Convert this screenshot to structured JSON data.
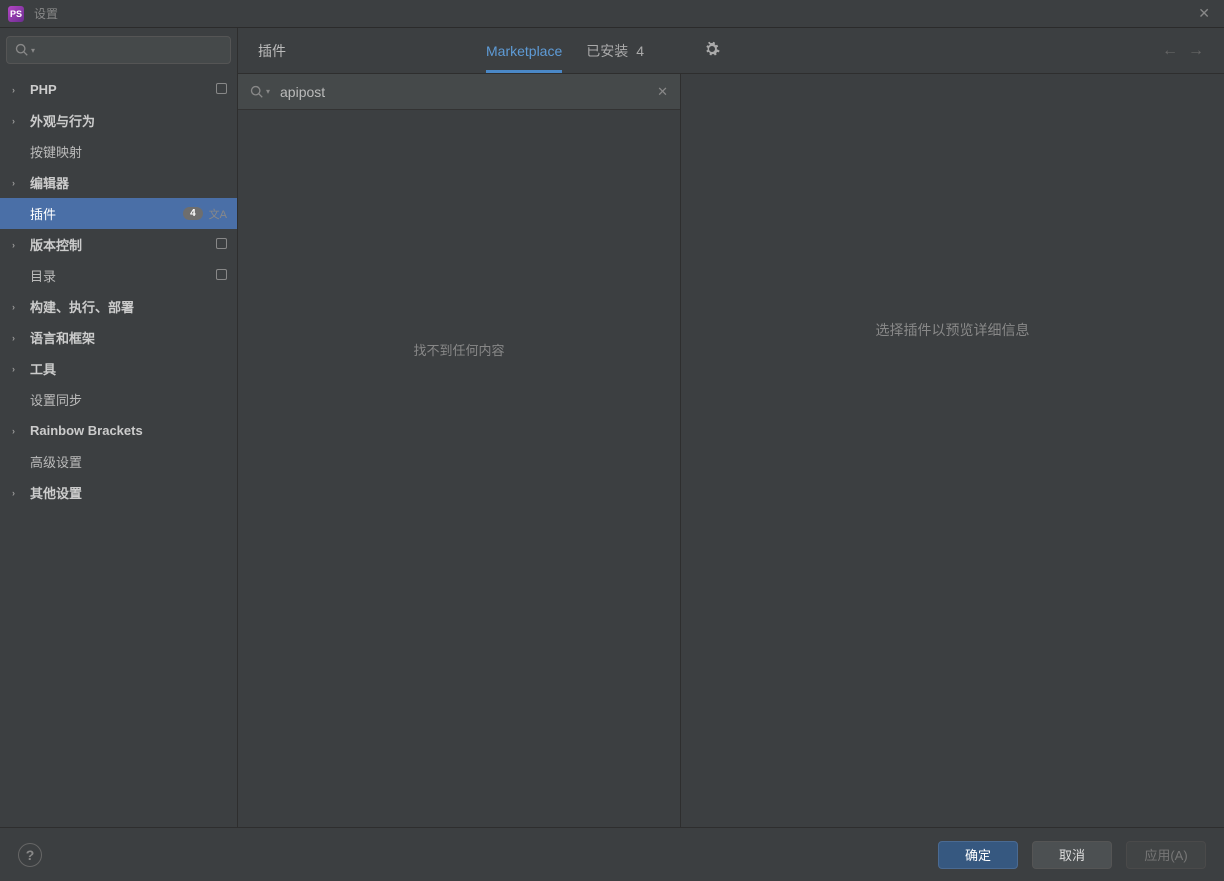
{
  "title": "设置",
  "sidebar": {
    "items": [
      {
        "label": "PHP",
        "expandable": true,
        "bold": true,
        "proj": true
      },
      {
        "label": "外观与行为",
        "expandable": true,
        "bold": true
      },
      {
        "label": "按键映射",
        "expandable": false,
        "bold": false,
        "indent": true
      },
      {
        "label": "编辑器",
        "expandable": true,
        "bold": true
      },
      {
        "label": "插件",
        "expandable": false,
        "bold": false,
        "indent": true,
        "selected": true,
        "badge": "4",
        "lang": true
      },
      {
        "label": "版本控制",
        "expandable": true,
        "bold": true,
        "proj": true
      },
      {
        "label": "目录",
        "expandable": false,
        "bold": false,
        "indent": true,
        "proj": true
      },
      {
        "label": "构建、执行、部署",
        "expandable": true,
        "bold": true
      },
      {
        "label": "语言和框架",
        "expandable": true,
        "bold": true
      },
      {
        "label": "工具",
        "expandable": true,
        "bold": true
      },
      {
        "label": "设置同步",
        "expandable": false,
        "bold": false,
        "indent": true
      },
      {
        "label": "Rainbow Brackets",
        "expandable": true,
        "bold": true
      },
      {
        "label": "高级设置",
        "expandable": false,
        "bold": false,
        "indent": true
      },
      {
        "label": "其他设置",
        "expandable": true,
        "bold": true
      }
    ]
  },
  "main": {
    "crumb": "插件",
    "tabs": {
      "marketplace": "Marketplace",
      "installed": "已安装",
      "installed_count": "4"
    },
    "search_value": "apipost",
    "list_empty": "找不到任何内容",
    "detail_empty": "选择插件以预览详细信息"
  },
  "footer": {
    "ok": "确定",
    "cancel": "取消",
    "apply": "应用(A)"
  }
}
